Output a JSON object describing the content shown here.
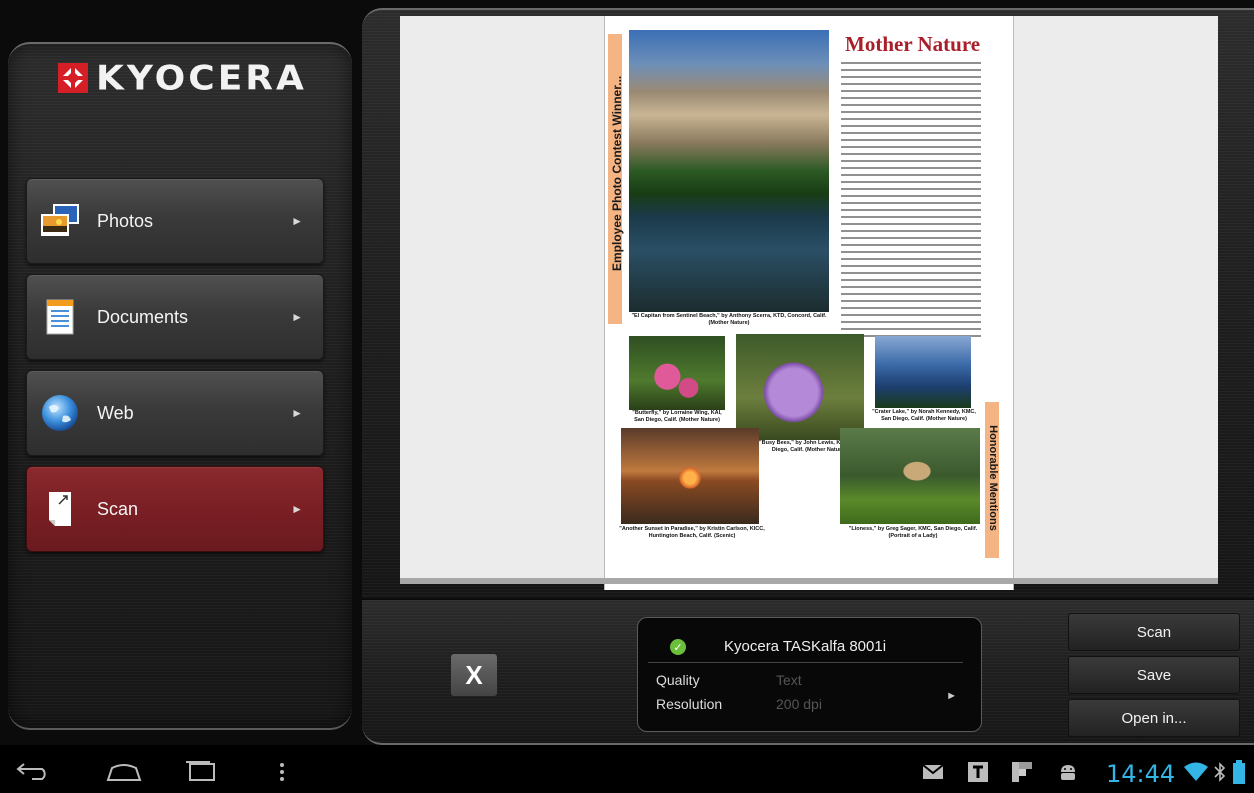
{
  "app": {
    "brand": "KYOCERA",
    "colors": {
      "brand_red": "#d41f27",
      "active_nav": "#7a1f24",
      "clock_blue": "#33b5e5",
      "check_green": "#6cbf3a"
    }
  },
  "sidebar": {
    "items": [
      {
        "label": "Photos",
        "icon": "photos-icon",
        "arrow": "►"
      },
      {
        "label": "Documents",
        "icon": "documents-icon",
        "arrow": "►"
      },
      {
        "label": "Web",
        "icon": "globe-icon",
        "arrow": "►"
      },
      {
        "label": "Scan",
        "icon": "scan-icon",
        "arrow": "►",
        "active": true
      }
    ]
  },
  "preview": {
    "article_title": "Mother Nature",
    "side_heading": "Employee Photo Contest Winner...",
    "honorable": "Honorable Mentions",
    "captions": {
      "main": "\"El Capitan from Sentinel Beach,\" by Anthony Scerra, KTD, Concord, Calif. (Mother Nature)",
      "butterfly": "\"Butterfly,\" by Lorraine Wing, KAI, San Diego, Calif. (Mother Nature)",
      "bees": "\"Busy Bees,\" by John Lewis, KAI, San Diego, Calif. (Mother Nature)",
      "crater": "\"Crater Lake,\" by Norah Kennedy, KMC, San Diego, Calif. (Mother Nature)",
      "sunset": "\"Another Sunset in Paradise,\" by Kristin Carlson, KICC, Huntington Beach, Calif. (Scenic)",
      "lioness": "\"Lioness,\" by Greg Sager, KMC, San Diego, Calif. (Portrait of a Lady)"
    }
  },
  "close_button": {
    "label": "X"
  },
  "printer": {
    "name": "Kyocera TASKalfa 8001i",
    "quality_label": "Quality",
    "quality_value": "Text",
    "resolution_label": "Resolution",
    "resolution_value": "200 dpi",
    "arrow": "►"
  },
  "actions": {
    "scan": "Scan",
    "save": "Save",
    "open_in": "Open in..."
  },
  "system_bar": {
    "clock": "14:44",
    "nav_icons": [
      "back-icon",
      "home-icon",
      "recent-apps-icon",
      "menu-icon"
    ],
    "status_icons": [
      "email-icon",
      "notification-t-icon",
      "flipboard-icon",
      "android-icon",
      "wifi-icon",
      "bluetooth-icon",
      "battery-icon"
    ]
  }
}
